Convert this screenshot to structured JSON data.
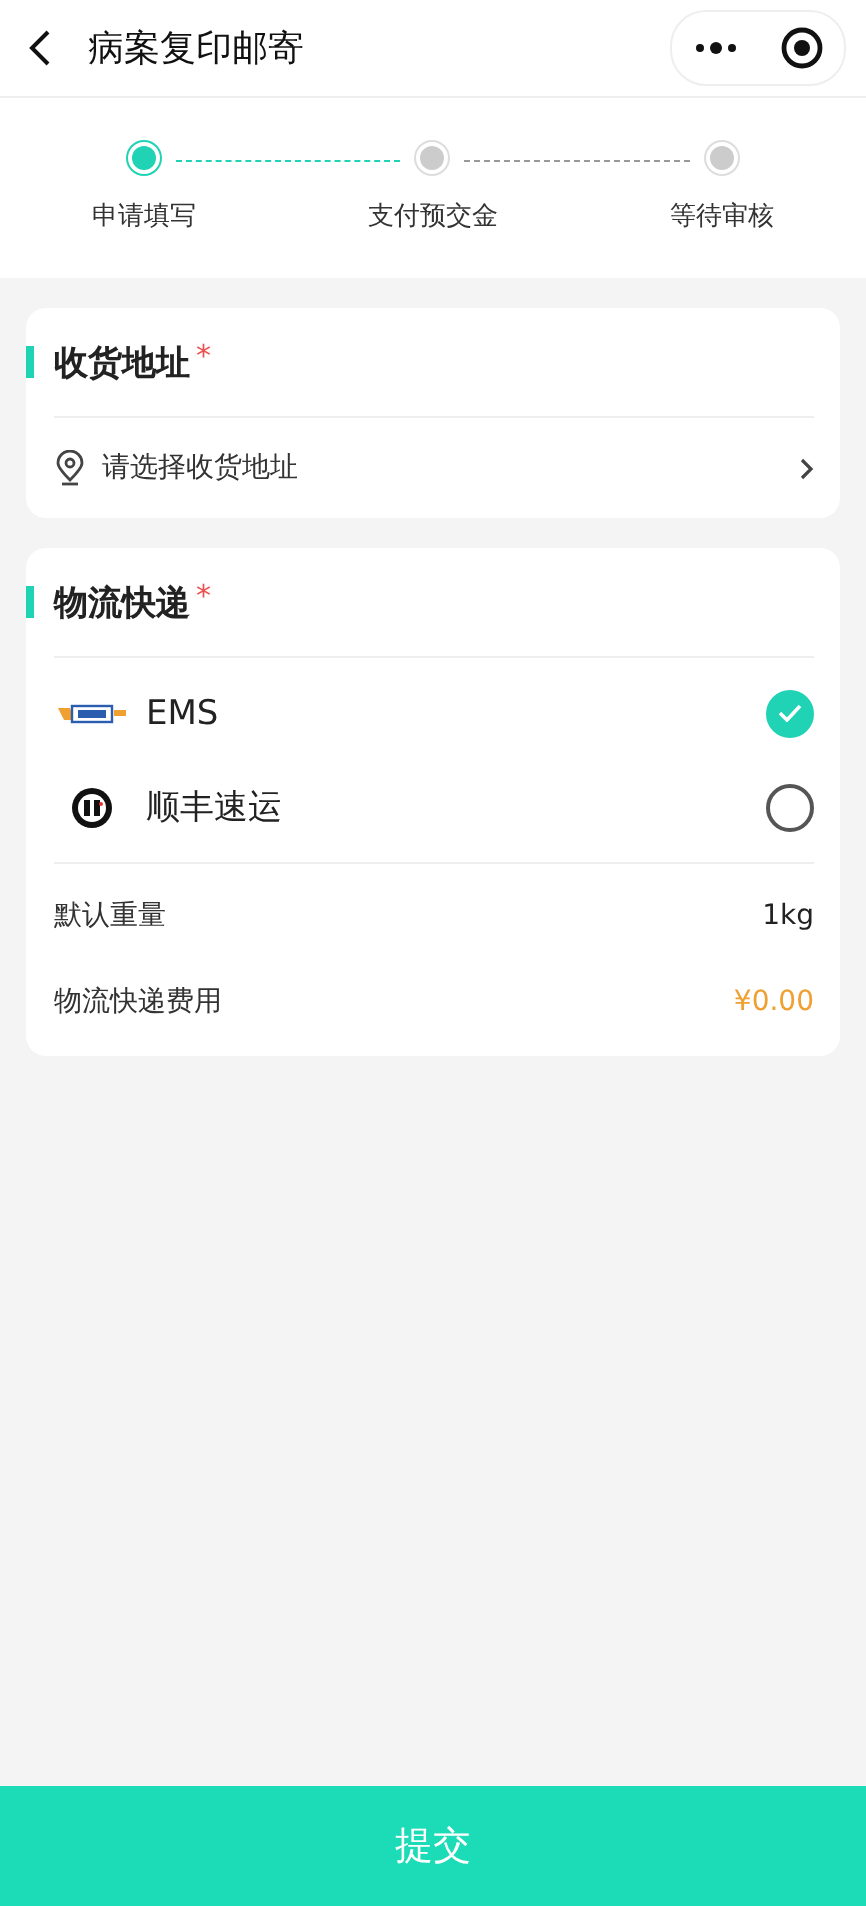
{
  "nav": {
    "title": "病案复印邮寄"
  },
  "steps": [
    {
      "label": "申请填写",
      "active": true
    },
    {
      "label": "支付预交金",
      "active": false
    },
    {
      "label": "等待审核",
      "active": false
    }
  ],
  "address": {
    "title": "收货地址",
    "required": "*",
    "placeholder": "请选择收货地址"
  },
  "logistics": {
    "title": "物流快递",
    "required": "*",
    "options": [
      {
        "kind": "ems",
        "label": "EMS",
        "selected": true
      },
      {
        "kind": "sf",
        "label": "顺丰速运",
        "selected": false
      }
    ],
    "rows": [
      {
        "label": "默认重量",
        "value": "1kg",
        "kind": "plain"
      },
      {
        "label": "物流快递费用",
        "value": "¥0.00",
        "kind": "price"
      }
    ]
  },
  "submit": "提交"
}
